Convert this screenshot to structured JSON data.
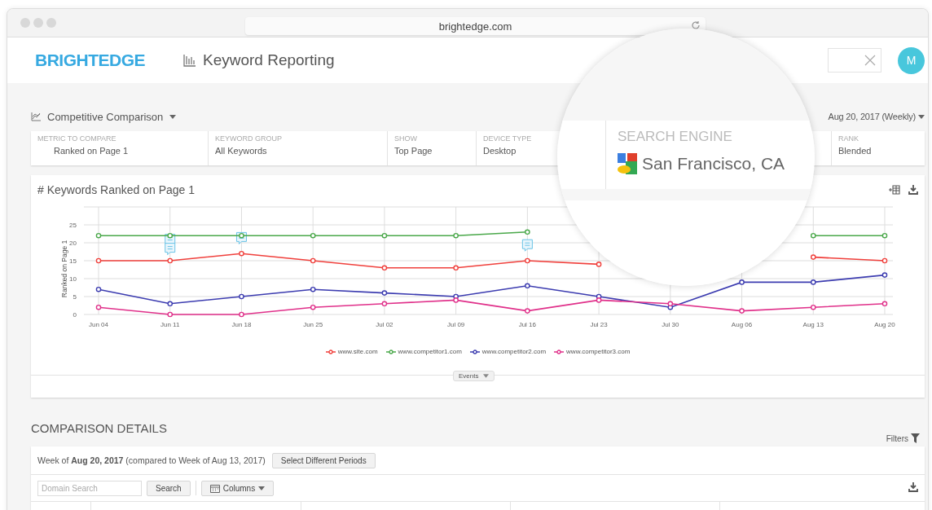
{
  "browser": {
    "url": "brightedge.com"
  },
  "header": {
    "logo": "BRIGHTEDGE",
    "title": "Keyword Reporting",
    "avatar": "M"
  },
  "toolbar": {
    "view": "Competitive Comparison",
    "date_range": "Aug 20, 2017 (Weekly)"
  },
  "filters": [
    {
      "label": "METRIC TO COMPARE",
      "value": "Ranked on Page 1"
    },
    {
      "label": "KEYWORD GROUP",
      "value": "All Keywords"
    },
    {
      "label": "SHOW",
      "value": "Top Page"
    },
    {
      "label": "DEVICE TYPE",
      "value": "Desktop"
    },
    {
      "label": "RANK",
      "value": "Blended"
    }
  ],
  "magnifier": {
    "label": "SEARCH ENGINE",
    "value": "San Francisco, CA"
  },
  "chart_card": {
    "title": "# Keywords Ranked on Page 1",
    "events_tab": "Events",
    "chart_data": {
      "type": "line",
      "ylabel": "Ranked on Page 1",
      "categories": [
        "Jun 04",
        "Jun 11",
        "Jun 18",
        "Jun 25",
        "Jul 02",
        "Jul 09",
        "Jul 16",
        "Jul 23",
        "Jul 30",
        "Aug 06",
        "Aug 13",
        "Aug 20"
      ],
      "ylim": [
        0,
        30
      ],
      "yticks": [
        0,
        5,
        10,
        15,
        20,
        25
      ],
      "grid": true,
      "series": [
        {
          "name": "www.site.com",
          "color": "#f0403c",
          "marker": true,
          "values": [
            15,
            15,
            17,
            15,
            13,
            13,
            15,
            14,
            null,
            null,
            16,
            15
          ]
        },
        {
          "name": "www.competitor1.com",
          "color": "#4aa84a",
          "marker": true,
          "values": [
            22,
            22,
            22,
            22,
            22,
            22,
            23,
            null,
            null,
            null,
            22,
            22
          ]
        },
        {
          "name": "www.competitor2.com",
          "color": "#3c3cb0",
          "marker": true,
          "values": [
            7,
            3,
            5,
            7,
            6,
            5,
            8,
            5,
            2,
            9,
            9,
            11
          ]
        },
        {
          "name": "www.competitor3.com",
          "color": "#e0308a",
          "marker": true,
          "values": [
            2,
            0,
            0,
            2,
            3,
            4,
            1,
            4,
            3,
            1,
            2,
            3
          ]
        }
      ]
    }
  },
  "details": {
    "heading": "COMPARISON DETAILS",
    "filters_link": "Filters",
    "period_text": "Week of **Aug 20, 2017** (compared to Week of Aug 13, 2017)",
    "period_button": "Select Different Periods",
    "search_placeholder": "Domain Search",
    "search_button": "Search",
    "columns_button": "Columns"
  }
}
